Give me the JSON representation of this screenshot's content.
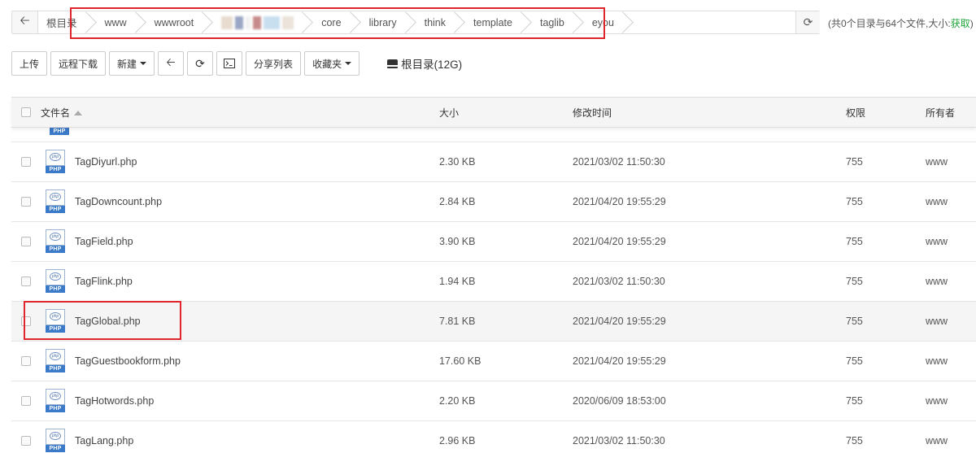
{
  "breadcrumb": {
    "items": [
      "根目录",
      "www",
      "wwwroot",
      "core",
      "library",
      "think",
      "template",
      "taglib",
      "eyou"
    ]
  },
  "summary": {
    "text": "(共0个目录与64个文件,大小:",
    "fetch_label": "获取",
    "close": ")"
  },
  "toolbar": {
    "upload": "上传",
    "remote_download": "远程下载",
    "new": "新建",
    "share_list": "分享列表",
    "favorites": "收藏夹",
    "disk": "根目录(12G)"
  },
  "table": {
    "headers": {
      "name": "文件名",
      "size": "大小",
      "mtime": "修改时间",
      "perm": "权限",
      "owner": "所有者"
    },
    "rows": [
      {
        "name": "TagDiyurl.php",
        "size": "2.30 KB",
        "mtime": "2021/03/02 11:50:30",
        "perm": "755",
        "owner": "www"
      },
      {
        "name": "TagDowncount.php",
        "size": "2.84 KB",
        "mtime": "2021/04/20 19:55:29",
        "perm": "755",
        "owner": "www"
      },
      {
        "name": "TagField.php",
        "size": "3.90 KB",
        "mtime": "2021/04/20 19:55:29",
        "perm": "755",
        "owner": "www"
      },
      {
        "name": "TagFlink.php",
        "size": "1.94 KB",
        "mtime": "2021/03/02 11:50:30",
        "perm": "755",
        "owner": "www"
      },
      {
        "name": "TagGlobal.php",
        "size": "7.81 KB",
        "mtime": "2021/04/20 19:55:29",
        "perm": "755",
        "owner": "www"
      },
      {
        "name": "TagGuestbookform.php",
        "size": "17.60 KB",
        "mtime": "2021/04/20 19:55:29",
        "perm": "755",
        "owner": "www"
      },
      {
        "name": "TagHotwords.php",
        "size": "2.20 KB",
        "mtime": "2020/06/09 18:53:00",
        "perm": "755",
        "owner": "www"
      },
      {
        "name": "TagLang.php",
        "size": "2.96 KB",
        "mtime": "2021/03/02 11:50:30",
        "perm": "755",
        "owner": "www"
      }
    ]
  },
  "file_icon_label": "PHP",
  "colors": {
    "accent_green": "#20a53a",
    "highlight_red": "#e0262d",
    "php_blue": "#3b79c9"
  }
}
